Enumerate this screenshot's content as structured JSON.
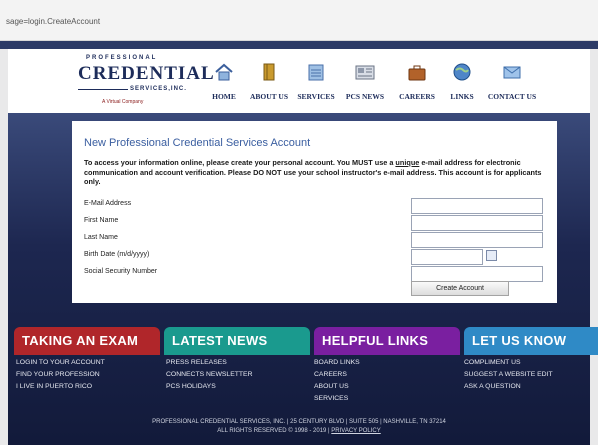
{
  "browser": {
    "url": "sage=login.CreateAccount"
  },
  "logo": {
    "line1": "PROFESSIONAL",
    "line2": "CREDENTIAL",
    "line3": "SERVICES,INC.",
    "line4": "A Virtual Company"
  },
  "nav": [
    {
      "label": "HOME",
      "icon": "home-icon"
    },
    {
      "label": "ABOUT US",
      "icon": "book-icon"
    },
    {
      "label": "SERVICES",
      "icon": "document-icon"
    },
    {
      "label": "PCS NEWS",
      "icon": "newspaper-icon"
    },
    {
      "label": "CAREERS",
      "icon": "briefcase-icon"
    },
    {
      "label": "LINKS",
      "icon": "globe-icon"
    },
    {
      "label": "CONTACT US",
      "icon": "contact-icon"
    }
  ],
  "form": {
    "title": "New Professional Credential Services Account",
    "desc_part1": "To access your information online, please create your personal account. You MUST use a ",
    "desc_underline": "unique",
    "desc_part2": " e-mail address for electronic communication and account verification.  Please DO NOT use your school instructor's e-mail address. This account is for applicants only.",
    "fields": [
      {
        "label": "E-Mail Address",
        "value": ""
      },
      {
        "label": "First Name",
        "value": ""
      },
      {
        "label": "Last Name",
        "value": ""
      },
      {
        "label": "Birth Date (m/d/yyyy)",
        "value": ""
      },
      {
        "label": "Social Security Number",
        "value": ""
      }
    ],
    "submit_label": "Create Account"
  },
  "bottom_tabs": [
    {
      "label": "TAKING AN EXAM",
      "color": "#b0262a",
      "links": [
        "LOGIN TO YOUR ACCOUNT",
        "FIND YOUR PROFESSION",
        "I LIVE IN PUERTO RICO"
      ]
    },
    {
      "label": "LATEST NEWS",
      "color": "#1a9a8e",
      "links": [
        "PRESS RELEASES",
        "CONNECTS NEWSLETTER",
        "PCS HOLIDAYS"
      ]
    },
    {
      "label": "HELPFUL LINKS",
      "color": "#7a1fa0",
      "links": [
        "BOARD LINKS",
        "CAREERS",
        "ABOUT US",
        "SERVICES"
      ]
    },
    {
      "label": "LET US KNOW",
      "color": "#2f8ac6",
      "links": [
        "COMPLIMENT US",
        "SUGGEST A WEBSITE EDIT",
        "ASK A QUESTION"
      ]
    }
  ],
  "footer": {
    "line1": "PROFESSIONAL CREDENTIAL SERVICES, INC. | 25 CENTURY BLVD | SUITE 505 | NASHVILLE, TN 37214",
    "line2_prefix": "ALL RIGHTS RESERVED © 1998 - 2019 | ",
    "privacy_link": "PRIVACY POLICY"
  }
}
